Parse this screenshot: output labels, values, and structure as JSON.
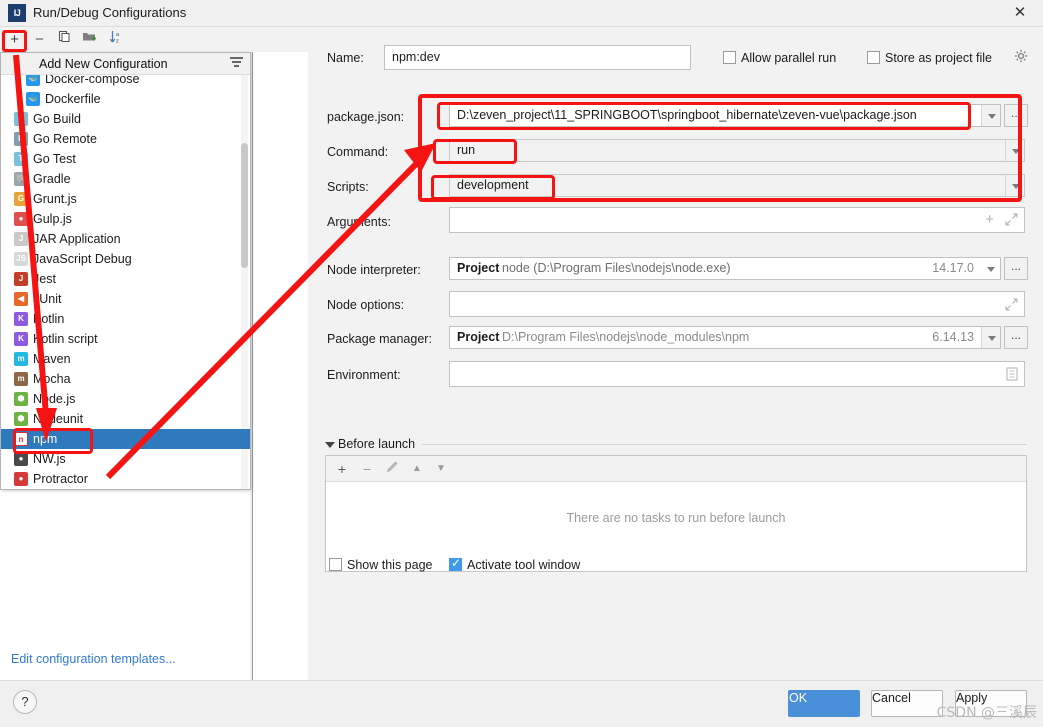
{
  "window": {
    "title": "Run/Debug Configurations",
    "logo_text": "IJ",
    "close_icon": "close-icon"
  },
  "left_toolbar": {
    "add_label": "+",
    "remove_label": "−",
    "copy_label": "⎘",
    "folder_label": "▰",
    "sort_label": "↓"
  },
  "left_panel": {
    "edit_templates_link": "Edit configuration templates..."
  },
  "popup": {
    "title": "Add New Configuration",
    "items": [
      {
        "label": "Docker-compose",
        "icon": "docker-icon",
        "color": "#2496ed",
        "glyph": "🐳",
        "indent": true,
        "selected": false
      },
      {
        "label": "Dockerfile",
        "icon": "docker-icon",
        "color": "#2496ed",
        "glyph": "🐳",
        "indent": true,
        "selected": false
      },
      {
        "label": "Go Build",
        "icon": "go-icon",
        "color": "#79c0db",
        "glyph": "G",
        "indent": false,
        "selected": false
      },
      {
        "label": "Go Remote",
        "icon": "go-remote-icon",
        "color": "#7f9fb0",
        "glyph": "R",
        "indent": false,
        "selected": false
      },
      {
        "label": "Go Test",
        "icon": "go-test-icon",
        "color": "#79c0db",
        "glyph": "T",
        "indent": false,
        "selected": false
      },
      {
        "label": "Gradle",
        "icon": "gradle-icon",
        "color": "#9aa7ad",
        "glyph": "🐘",
        "indent": false,
        "selected": false
      },
      {
        "label": "Grunt.js",
        "icon": "grunt-icon",
        "color": "#e8a33d",
        "glyph": "G",
        "indent": false,
        "selected": false
      },
      {
        "label": "Gulp.js",
        "icon": "gulp-icon",
        "color": "#e04e4e",
        "glyph": "●",
        "indent": false,
        "selected": false
      },
      {
        "label": "JAR Application",
        "icon": "jar-icon",
        "color": "#c8c8c8",
        "glyph": "J",
        "indent": false,
        "selected": false
      },
      {
        "label": "JavaScript Debug",
        "icon": "javascript-debug-icon",
        "color": "#d8d8d8",
        "glyph": "JS",
        "indent": false,
        "selected": false
      },
      {
        "label": "Jest",
        "icon": "jest-icon",
        "color": "#c2402a",
        "glyph": "J",
        "indent": false,
        "selected": false
      },
      {
        "label": "JUnit",
        "icon": "junit-icon",
        "color": "#e8672b",
        "glyph": "◀",
        "indent": false,
        "selected": false
      },
      {
        "label": "Kotlin",
        "icon": "kotlin-icon",
        "color": "#8e5ae0",
        "glyph": "K",
        "indent": false,
        "selected": false
      },
      {
        "label": "Kotlin script",
        "icon": "kotlin-script-icon",
        "color": "#8e5ae0",
        "glyph": "K",
        "indent": false,
        "selected": false
      },
      {
        "label": "Maven",
        "icon": "maven-icon",
        "color": "#23b9e0",
        "glyph": "m",
        "indent": false,
        "selected": false
      },
      {
        "label": "Mocha",
        "icon": "mocha-icon",
        "color": "#8d6748",
        "glyph": "m",
        "indent": false,
        "selected": false
      },
      {
        "label": "Node.js",
        "icon": "nodejs-icon",
        "color": "#6cb344",
        "glyph": "⬢",
        "indent": false,
        "selected": false
      },
      {
        "label": "Nodeunit",
        "icon": "nodeunit-icon",
        "color": "#6cb344",
        "glyph": "⬢",
        "indent": false,
        "selected": false
      },
      {
        "label": "npm",
        "icon": "npm-icon",
        "color": "#cb3837",
        "glyph": "n",
        "indent": false,
        "selected": true
      },
      {
        "label": "NW.js",
        "icon": "nwjs-icon",
        "color": "#4a4a4a",
        "glyph": "●",
        "indent": false,
        "selected": false
      },
      {
        "label": "Protractor",
        "icon": "protractor-icon",
        "color": "#d53a3a",
        "glyph": "●",
        "indent": false,
        "selected": false
      }
    ]
  },
  "form": {
    "name_label": "Name:",
    "name_value": "npm:dev",
    "allow_parallel_run_label": "Allow parallel run",
    "allow_parallel_run_checked": false,
    "store_as_project_file_label": "Store as project file",
    "store_as_project_file_checked": false,
    "package_json_label": "package.json:",
    "package_json_value": "D:\\zeven_project\\11_SPRINGBOOT\\springboot_hibernate\\zeven-vue\\package.json",
    "command_label": "Command:",
    "command_value": "run",
    "scripts_label": "Scripts:",
    "scripts_value": "development",
    "arguments_label": "Arguments:",
    "arguments_value": "",
    "node_interpreter_label": "Node interpreter:",
    "node_interpreter_scope": "Project",
    "node_interpreter_value": "node (D:\\Program Files\\nodejs\\node.exe)",
    "node_interpreter_version": "14.17.0",
    "node_options_label": "Node options:",
    "node_options_value": "",
    "package_manager_label": "Package manager:",
    "package_manager_scope": "Project",
    "package_manager_value": "D:\\Program Files\\nodejs\\node_modules\\npm",
    "package_manager_version": "6.14.13",
    "environment_label": "Environment:",
    "environment_value": "",
    "ellipsis_label": "...",
    "plus_icon": "plus-icon",
    "expand_icon": "expand-icon",
    "env_icon": "environment-list-icon",
    "gear_icon": "gear-icon"
  },
  "before_launch": {
    "section_label": "Before launch",
    "empty_text": "There are no tasks to run before launch",
    "toolbar": {
      "add": "+",
      "remove": "−",
      "edit": "✐",
      "up": "▲",
      "down": "▼"
    },
    "show_this_page_label": "Show this page",
    "show_this_page_checked": false,
    "activate_tool_window_label": "Activate tool window",
    "activate_tool_window_checked": true
  },
  "footer": {
    "help_label": "?",
    "ok_label": "OK",
    "cancel_label": "Cancel",
    "apply_label": "Apply"
  },
  "watermark": "CSDN @三溪辰",
  "colors": {
    "accent": "#4a90d9",
    "annotation": "#f41414",
    "selection": "#2f79bf",
    "link": "#2f7bd4"
  }
}
